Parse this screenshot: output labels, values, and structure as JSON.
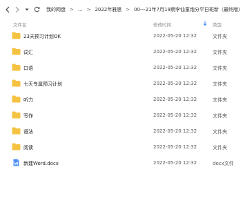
{
  "toolbar": {
    "back_icon": "back-arrow-icon",
    "forward_icon": "forward-arrow-icon",
    "history_icon": "chevron-down-icon",
    "refresh_icon": "refresh-icon"
  },
  "breadcrumb": {
    "items": [
      {
        "label": "我的网盘"
      },
      {
        "label": "..."
      },
      {
        "label": "2022年雅思"
      },
      {
        "label": "00---21年7月19期李仙童炮分平日班新（最终版）"
      }
    ],
    "separator": ">"
  },
  "columns": {
    "name": "文件名",
    "date": "修改时间",
    "type": "类型"
  },
  "colors": {
    "folder": "#F5C242",
    "doc": "#4A8CF7",
    "sort_arrow": "#3B82F6"
  },
  "files": [
    {
      "name": "23天预习计划OK",
      "date": "2022-05-20 12:32",
      "type": "文件夹",
      "icon": "folder-icon"
    },
    {
      "name": "词汇",
      "date": "2022-05-20 12:32",
      "type": "文件夹",
      "icon": "folder-icon"
    },
    {
      "name": "口语",
      "date": "2022-05-20 12:32",
      "type": "文件夹",
      "icon": "folder-icon"
    },
    {
      "name": "七天专属预习计划",
      "date": "2022-05-20 12:32",
      "type": "文件夹",
      "icon": "folder-icon"
    },
    {
      "name": "听力",
      "date": "2022-05-20 12:32",
      "type": "文件夹",
      "icon": "folder-icon"
    },
    {
      "name": "写作",
      "date": "2022-05-20 12:32",
      "type": "文件夹",
      "icon": "folder-icon"
    },
    {
      "name": "语法",
      "date": "2022-05-20 12:32",
      "type": "文件夹",
      "icon": "folder-icon"
    },
    {
      "name": "阅读",
      "date": "2022-05-20 12:32",
      "type": "文件夹",
      "icon": "folder-icon"
    },
    {
      "name": "新建Word.docx",
      "date": "2022-05-20 12:32",
      "type": "docx文件",
      "icon": "word-doc-icon"
    }
  ]
}
